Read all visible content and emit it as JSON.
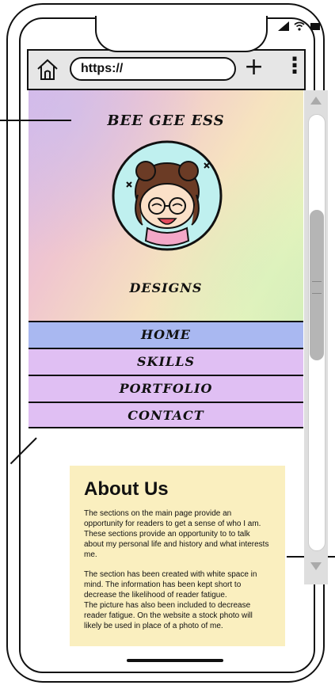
{
  "browser": {
    "url": "https://",
    "icons": [
      "home-icon",
      "plus-icon",
      "more-vertical-icon"
    ]
  },
  "status_bar": {
    "icons": [
      "signal-icon",
      "wifi-icon",
      "battery-icon"
    ]
  },
  "hero": {
    "brand_top": "BEE GEE ESS",
    "brand_bottom": "DESIGNS"
  },
  "nav": {
    "items": [
      {
        "label": "HOME"
      },
      {
        "label": "SKILLS"
      },
      {
        "label": "PORTFOLIO"
      },
      {
        "label": "CONTACT"
      }
    ],
    "colors": {
      "active": "#a9b8f1",
      "inactive": "#e0bff3"
    }
  },
  "about": {
    "heading": "About Us",
    "paragraph1": "The sections on the main page provide an opportunity for readers to get a sense of who I am. These sections provide an opportunity to to talk about my personal life and history and what interests me.",
    "paragraph2": "The section has been created with white space in mind. The information has been kept short to decrease the likelihood of reader fatigue.",
    "paragraph3": "The picture has also been included to decrease reader fatigue. On the website a stock photo will likely be used in place of a photo of me.",
    "background": "#faefbf"
  }
}
